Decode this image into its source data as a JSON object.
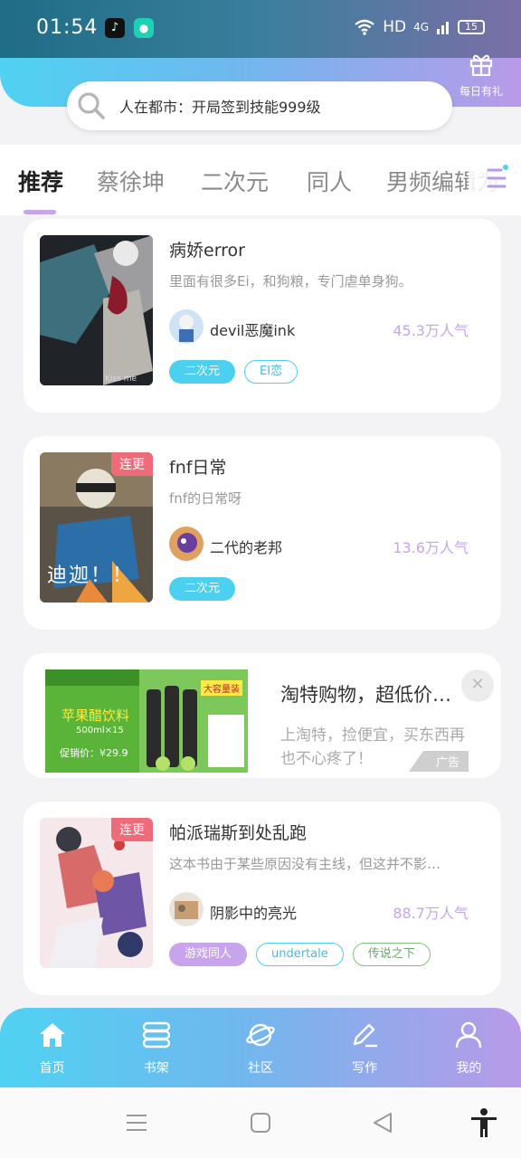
{
  "status": {
    "time": "01:54",
    "network": "HD",
    "signal": "4G",
    "battery": "15"
  },
  "header": {
    "gift_label": "每日有礼"
  },
  "search": {
    "text": "人在都市：开局签到技能999级"
  },
  "tabs": [
    {
      "label": "推荐"
    },
    {
      "label": "蔡徐坤"
    },
    {
      "label": "二次元"
    },
    {
      "label": "同人"
    },
    {
      "label": "男频编辑为"
    }
  ],
  "books": [
    {
      "title": "病娇error",
      "desc": "里面有很多Ei，和狗粮，专门虐单身狗。",
      "author": "devil恶魔ink",
      "popularity": "45.3万人气",
      "cover_caption": "Kiss me",
      "tags": [
        "二次元",
        "EI恋"
      ]
    },
    {
      "title": "fnf日常",
      "desc": "fnf的日常呀",
      "author": "二代的老邦",
      "popularity": "13.6万人气",
      "corner": "连更",
      "cover_caption": "迪迦！！",
      "tags": [
        "二次元"
      ]
    },
    {
      "title": "帕派瑞斯到处乱跑",
      "desc": "这本书由于某些原因没有主线，但这并不影…",
      "author": "阴影中的亮光",
      "popularity": "88.7万人气",
      "corner": "连更",
      "tags": [
        "游戏同人",
        "undertale",
        "传说之下"
      ]
    }
  ],
  "ad": {
    "title": "淘特购物，超低价…",
    "desc": "上淘特，捡便宜，买东西再也不心疼了！",
    "badge": "广告",
    "close": "✕",
    "img_line1": "苹果醋饮料",
    "img_line2": "500ml×15",
    "img_line3": "促销价：¥29.9",
    "img_tag": "大容量装"
  },
  "nav": [
    {
      "label": "首页",
      "icon": "home-icon"
    },
    {
      "label": "书架",
      "icon": "bookshelf-icon"
    },
    {
      "label": "社区",
      "icon": "planet-icon"
    },
    {
      "label": "写作",
      "icon": "pen-icon"
    },
    {
      "label": "我的",
      "icon": "profile-icon"
    }
  ],
  "colors": {
    "accent_blue": "#4fd2f2",
    "accent_purple": "#b89ae8",
    "popularity": "#c7a5ea",
    "corner_tag": "#ee6b7a"
  }
}
